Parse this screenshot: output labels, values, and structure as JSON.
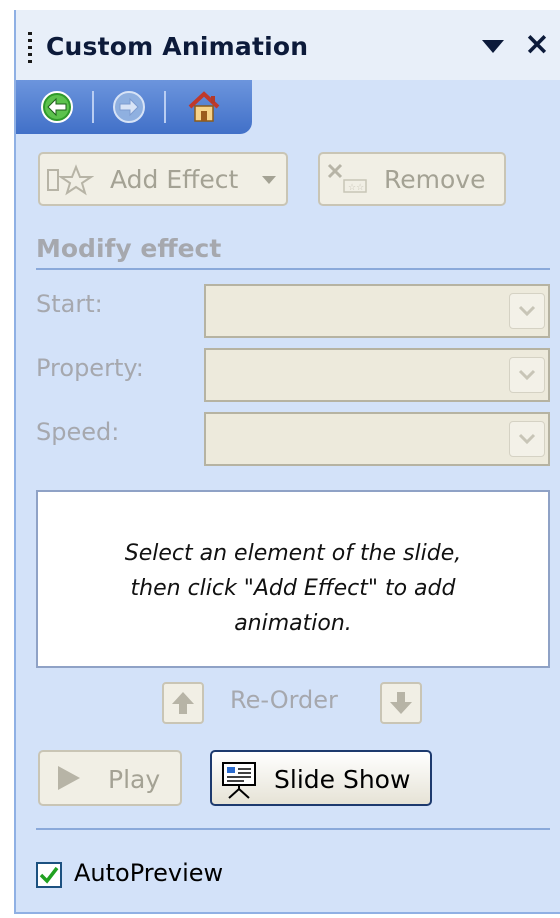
{
  "pane": {
    "title": "Custom Animation",
    "dropdown_icon": "triangle-down-icon",
    "close_glyph": "×"
  },
  "nav": {
    "back_icon": "back-arrow-icon",
    "forward_icon": "forward-arrow-icon",
    "home_icon": "home-icon"
  },
  "toolbar": {
    "add_effect_label": "Add Effect",
    "remove_label": "Remove"
  },
  "modify": {
    "heading": "Modify effect",
    "start_label": "Start:",
    "property_label": "Property:",
    "speed_label": "Speed:",
    "start_value": "",
    "property_value": "",
    "speed_value": ""
  },
  "hint_lines": [
    "Select an element of the slide,",
    "then click \"Add Effect\" to add",
    "animation."
  ],
  "reorder": {
    "label": "Re-Order"
  },
  "actions": {
    "play_label": "Play",
    "slideshow_label": "Slide Show"
  },
  "autopreview": {
    "label": "AutoPreview",
    "checked": true
  },
  "colors": {
    "pane_bg": "#d3e2f9",
    "nav_bg": "#4170c8",
    "disabled_text": "#a4a294",
    "check_green": "#21a121"
  }
}
